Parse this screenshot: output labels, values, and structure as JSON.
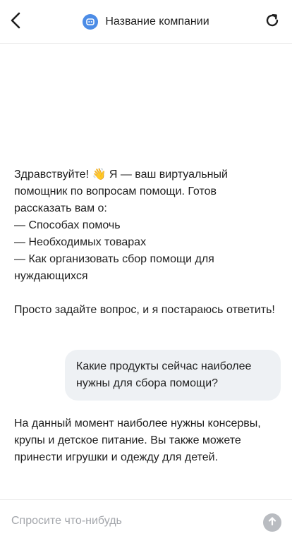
{
  "header": {
    "company_name": "Название компании",
    "back_icon": "chevron-left-icon",
    "refresh_icon": "refresh-icon",
    "logo_icon": "chat-bot-icon",
    "logo_color": "#4c8ce6"
  },
  "messages": {
    "greeting": {
      "line1": "Здравствуйте! 👋 Я — ваш виртуальный помощник по вопросам помощи. Готов рассказать вам о:",
      "item1": "— Способах помочь",
      "item2": "— Необходимых товарах",
      "item3": "— Как организовать сбор помощи для нуждающихся",
      "closing": "Просто задайте вопрос, и я постараюсь ответить!"
    },
    "user_question": "Какие продукты сейчас наиболее нужны для сбора помощи?",
    "bot_answer": "На данный момент наиболее нужны консервы, крупы и детское питание. Вы также можете принести игрушки и одежду для детей."
  },
  "composer": {
    "placeholder": "Спросите что-нибудь",
    "value": "",
    "send_icon": "arrow-up-icon"
  },
  "colors": {
    "user_bubble": "#eef1f4",
    "send_button": "#b9bcc1",
    "text": "#1f1f1f"
  }
}
